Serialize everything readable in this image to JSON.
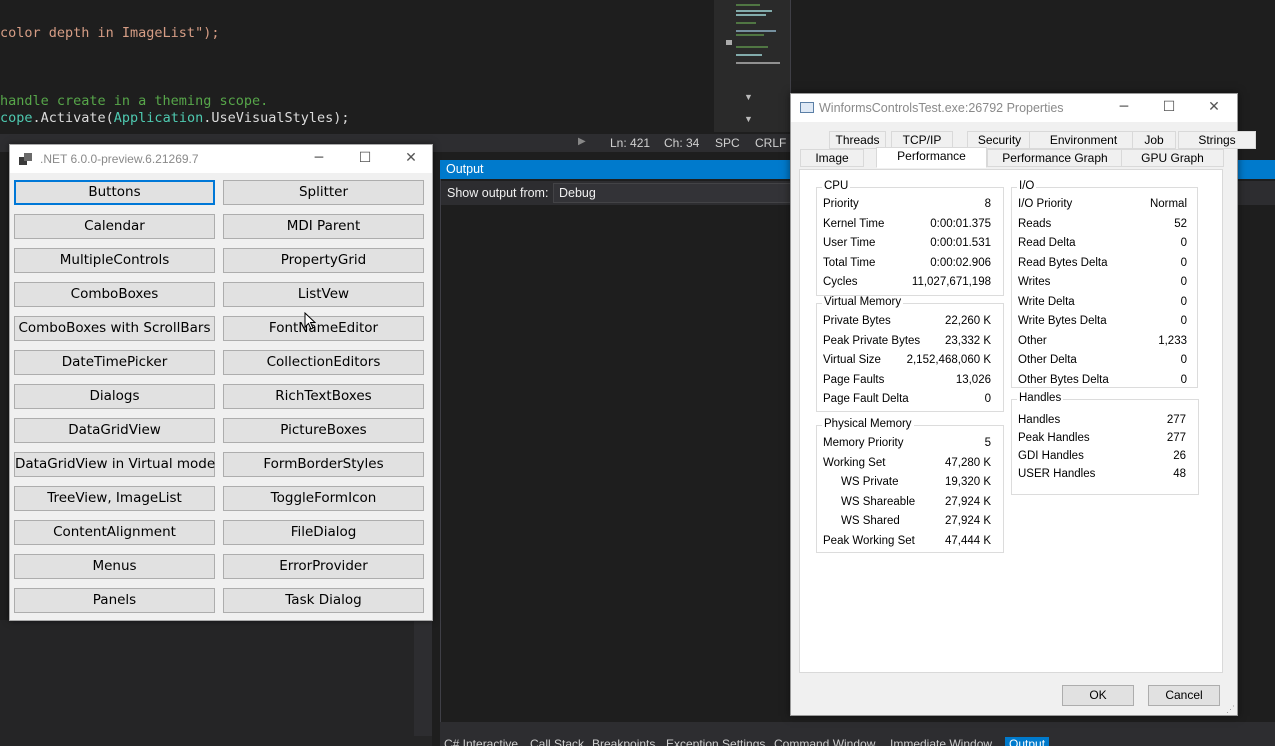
{
  "ide": {
    "code": {
      "line1": "color depth in ImageList\");",
      "line2_comment": "handle create in a theming scope.",
      "line3_a": "cope",
      "line3_b": ".Activate(",
      "line3_c": "Application",
      "line3_d": ".UseVisualStyles);"
    },
    "status": {
      "ln": "Ln: 421",
      "ch": "Ch: 34",
      "spc": "SPC",
      "crlf": "CRLF"
    },
    "output": {
      "title": "Output",
      "show_from_label": "Show output from:",
      "show_from_value": "Debug"
    },
    "bottom_tabs": [
      "C# Interactive",
      "Call Stack",
      "Breakpoints",
      "Exception Settings",
      "Command Window",
      "Immediate Window",
      "Output"
    ],
    "colors": {
      "accent": "#007acc",
      "bg": "#1e1e1e",
      "comment": "#57a64a",
      "string": "#d69d85"
    }
  },
  "launcher": {
    "title": ".NET 6.0.0-preview.6.21269.7",
    "buttons_left": [
      "Buttons",
      "Calendar",
      "MultipleControls",
      "ComboBoxes",
      "ComboBoxes with ScrollBars",
      "DateTimePicker",
      "Dialogs",
      "DataGridView",
      "DataGridView in Virtual mode",
      "TreeView, ImageList",
      "ContentAlignment",
      "Menus",
      "Panels"
    ],
    "buttons_right": [
      "Splitter",
      "MDI Parent",
      "PropertyGrid",
      "ListVew",
      "FontNameEditor",
      "CollectionEditors",
      "RichTextBoxes",
      "PictureBoxes",
      "FormBorderStyles",
      "ToggleFormIcon",
      "FileDialog",
      "ErrorProvider",
      "Task Dialog"
    ],
    "focused_button": "Buttons"
  },
  "props": {
    "title": "WinformsControlsTest.exe:26792 Properties",
    "tabs_row1": [
      "Threads",
      "TCP/IP",
      "Security",
      "Environment",
      "Job",
      "Strings"
    ],
    "tabs_row2": [
      "Image",
      "Performance",
      "Performance Graph",
      "GPU Graph"
    ],
    "active_tab": "Performance",
    "cpu": {
      "label": "CPU",
      "rows": [
        {
          "k": "Priority",
          "v": "8"
        },
        {
          "k": "Kernel Time",
          "v": "0:00:01.375"
        },
        {
          "k": "User Time",
          "v": "0:00:01.531"
        },
        {
          "k": "Total Time",
          "v": "0:00:02.906"
        },
        {
          "k": "Cycles",
          "v": "11,027,671,198"
        }
      ]
    },
    "virtual_memory": {
      "label": "Virtual Memory",
      "rows": [
        {
          "k": "Private Bytes",
          "v": "22,260 K"
        },
        {
          "k": "Peak Private Bytes",
          "v": "23,332 K"
        },
        {
          "k": "Virtual Size",
          "v": "2,152,468,060 K"
        },
        {
          "k": "Page Faults",
          "v": "13,026"
        },
        {
          "k": "Page Fault Delta",
          "v": "0"
        }
      ]
    },
    "physical_memory": {
      "label": "Physical Memory",
      "rows": [
        {
          "k": "Memory Priority",
          "v": "5"
        },
        {
          "k": "Working Set",
          "v": "47,280 K"
        },
        {
          "k": "WS Private",
          "v": "19,320 K"
        },
        {
          "k": "WS Shareable",
          "v": "27,924 K"
        },
        {
          "k": "WS Shared",
          "v": "27,924 K"
        },
        {
          "k": "Peak Working Set",
          "v": "47,444 K"
        }
      ]
    },
    "io": {
      "label": "I/O",
      "rows": [
        {
          "k": "I/O Priority",
          "v": "Normal"
        },
        {
          "k": "Reads",
          "v": "52"
        },
        {
          "k": "Read Delta",
          "v": "0"
        },
        {
          "k": "Read Bytes Delta",
          "v": "0"
        },
        {
          "k": "Writes",
          "v": "0"
        },
        {
          "k": "Write Delta",
          "v": "0"
        },
        {
          "k": "Write Bytes Delta",
          "v": "0"
        },
        {
          "k": "Other",
          "v": "1,233"
        },
        {
          "k": "Other Delta",
          "v": "0"
        },
        {
          "k": "Other Bytes Delta",
          "v": "0"
        }
      ]
    },
    "handles": {
      "label": "Handles",
      "rows": [
        {
          "k": "Handles",
          "v": "277"
        },
        {
          "k": "Peak Handles",
          "v": "277"
        },
        {
          "k": "GDI Handles",
          "v": "26"
        },
        {
          "k": "USER Handles",
          "v": "48"
        }
      ]
    },
    "ok_label": "OK",
    "cancel_label": "Cancel"
  }
}
